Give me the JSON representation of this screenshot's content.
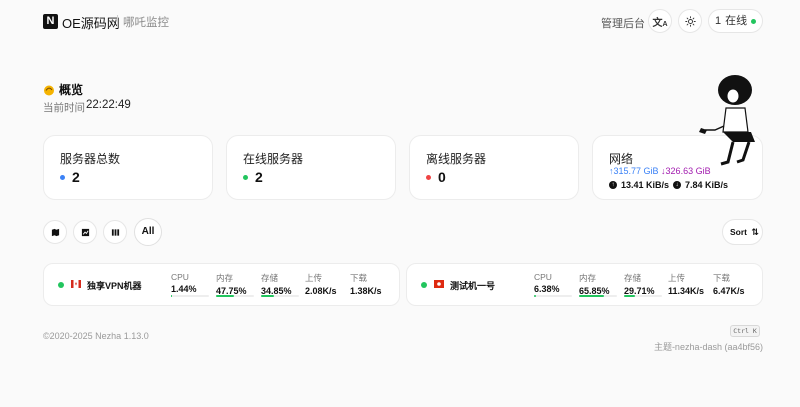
{
  "header": {
    "logo_letter": "N",
    "site_name": "OE源码网",
    "site_subtitle": "哪吒监控",
    "admin_link": "管理后台",
    "translate_icon": "translate-icon",
    "theme_icon": "sun-icon",
    "online_count": "1",
    "online_label": "在线"
  },
  "overview": {
    "title": "概览",
    "time_label": "当前时间",
    "time_value": "22:22:49"
  },
  "cards": {
    "total": {
      "title": "服务器总数",
      "value": "2",
      "dot_color": "#3b82f6"
    },
    "online": {
      "title": "在线服务器",
      "value": "2",
      "dot_color": "#22c55e"
    },
    "offline": {
      "title": "离线服务器",
      "value": "0",
      "dot_color": "#ef4444"
    },
    "network": {
      "title": "网络",
      "upload_total": "↑315.77 GiB",
      "download_total": "↓326.63 GiB",
      "upload_speed": "13.41 KiB/s",
      "download_speed": "7.84 KiB/s"
    }
  },
  "toolbar": {
    "map_icon": "map-icon",
    "chart_icon": "chart-icon",
    "grid_icon": "grid-icon",
    "all_label": "All",
    "sort_label": "Sort"
  },
  "servers": [
    {
      "name": "独享VPN机器",
      "flag": "ca-flag-icon",
      "cpu_label": "CPU",
      "cpu": "1.44%",
      "cpu_pct": 1.44,
      "mem_label": "内存",
      "mem": "47.75%",
      "mem_pct": 47.75,
      "disk_label": "存储",
      "disk": "34.85%",
      "disk_pct": 34.85,
      "up_label": "上传",
      "up": "2.08K/s",
      "down_label": "下载",
      "down": "1.38K/s"
    },
    {
      "name": "测试机一号",
      "flag": "hk-flag-icon",
      "cpu_label": "CPU",
      "cpu": "6.38%",
      "cpu_pct": 6.38,
      "mem_label": "内存",
      "mem": "65.85%",
      "mem_pct": 65.85,
      "disk_label": "存储",
      "disk": "29.71%",
      "disk_pct": 29.71,
      "up_label": "上传",
      "up": "11.34K/s",
      "down_label": "下载",
      "down": "6.47K/s"
    }
  ],
  "footer": {
    "copyright": "©2020-2025 Nezha 1.13.0",
    "shortcut": "Ctrl K",
    "theme": "主题-nezha-dash (aa4bf56)"
  }
}
